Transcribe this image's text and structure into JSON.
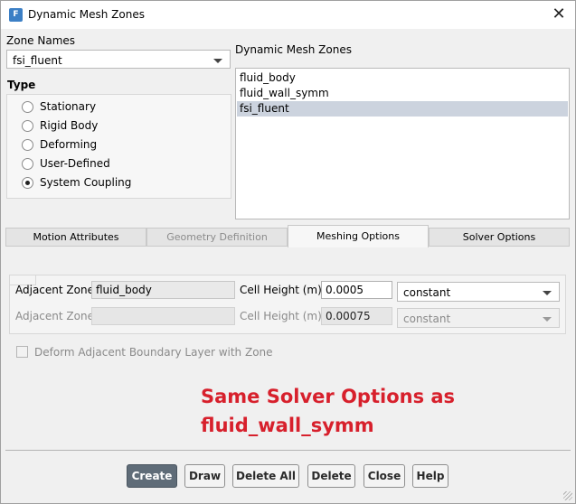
{
  "window": {
    "title": "Dynamic Mesh Zones",
    "icon_letter": "F",
    "close_glyph": "✕"
  },
  "zone_names": {
    "label": "Zone Names",
    "selected": "fsi_fluent"
  },
  "type": {
    "label": "Type",
    "options": [
      {
        "label": "Stationary",
        "selected": false
      },
      {
        "label": "Rigid Body",
        "selected": false
      },
      {
        "label": "Deforming",
        "selected": false
      },
      {
        "label": "User-Defined",
        "selected": false
      },
      {
        "label": "System Coupling",
        "selected": true
      }
    ]
  },
  "dynamic_zones": {
    "label": "Dynamic Mesh Zones",
    "items": [
      "fluid_body",
      "fluid_wall_symm",
      "fsi_fluent"
    ],
    "selected_index": 2
  },
  "tabs": [
    {
      "label": "Motion Attributes",
      "state": "normal"
    },
    {
      "label": "Geometry Definition",
      "state": "disabled"
    },
    {
      "label": "Meshing Options",
      "state": "active"
    },
    {
      "label": "Solver Options",
      "state": "normal"
    }
  ],
  "meshing": {
    "row1": {
      "zone_label": "Adjacent Zone",
      "zone_value": "fluid_body",
      "height_label": "Cell Height (m)",
      "height_value": "0.0005",
      "method": "constant"
    },
    "row2": {
      "zone_label": "Adjacent Zone",
      "zone_value": "",
      "height_label": "Cell Height (m)",
      "height_value": "0.00075",
      "method": "constant"
    },
    "deform_checkbox": {
      "label": "Deform Adjacent Boundary Layer with Zone",
      "checked": false
    }
  },
  "annotation": {
    "line1": "Same Solver Options as",
    "line2": "fluid_wall_symm",
    "color": "#d7202c"
  },
  "buttons": {
    "create": "Create",
    "draw": "Draw",
    "delete_all": "Delete All",
    "delete": "Delete",
    "close": "Close",
    "help": "Help"
  }
}
